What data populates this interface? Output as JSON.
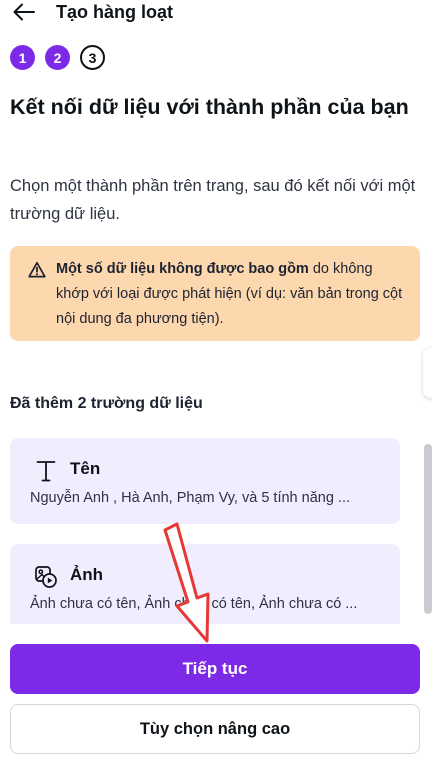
{
  "header": {
    "title": "Tạo hàng loạt",
    "back_icon": "arrow-left-icon"
  },
  "steps": [
    {
      "label": "1",
      "state": "done"
    },
    {
      "label": "2",
      "state": "done"
    },
    {
      "label": "3",
      "state": "current"
    }
  ],
  "heading": "Kết nối dữ liệu với thành phần của bạn",
  "description": "Chọn một thành phần trên trang, sau đó kết nối với một trường dữ liệu.",
  "warning": {
    "icon": "warning-triangle-icon",
    "bold": "Một số dữ liệu không được bao gồm",
    "rest": " do không khớp với loại được phát hiện (ví dụ: văn bản trong cột nội dung đa phương tiện)."
  },
  "fields": {
    "heading": "Đã thêm 2 trường dữ liệu",
    "items": [
      {
        "icon": "text-type-icon",
        "label": "Tên",
        "values": "Nguyễn Anh , Hà Anh, Phạm Vy, và 5 tính năng ..."
      },
      {
        "icon": "image-video-icon",
        "label": "Ảnh",
        "values": "Ảnh chưa có tên, Ảnh chưa có tên, Ảnh chưa có ..."
      }
    ]
  },
  "buttons": {
    "continue": "Tiếp tục",
    "advanced": "Tùy chọn nâng cao"
  },
  "colors": {
    "accent": "#7d2ae8",
    "warning_bg": "#fdd7ae",
    "card_bg": "#f1edfe",
    "annotation_arrow": "#e53935"
  }
}
